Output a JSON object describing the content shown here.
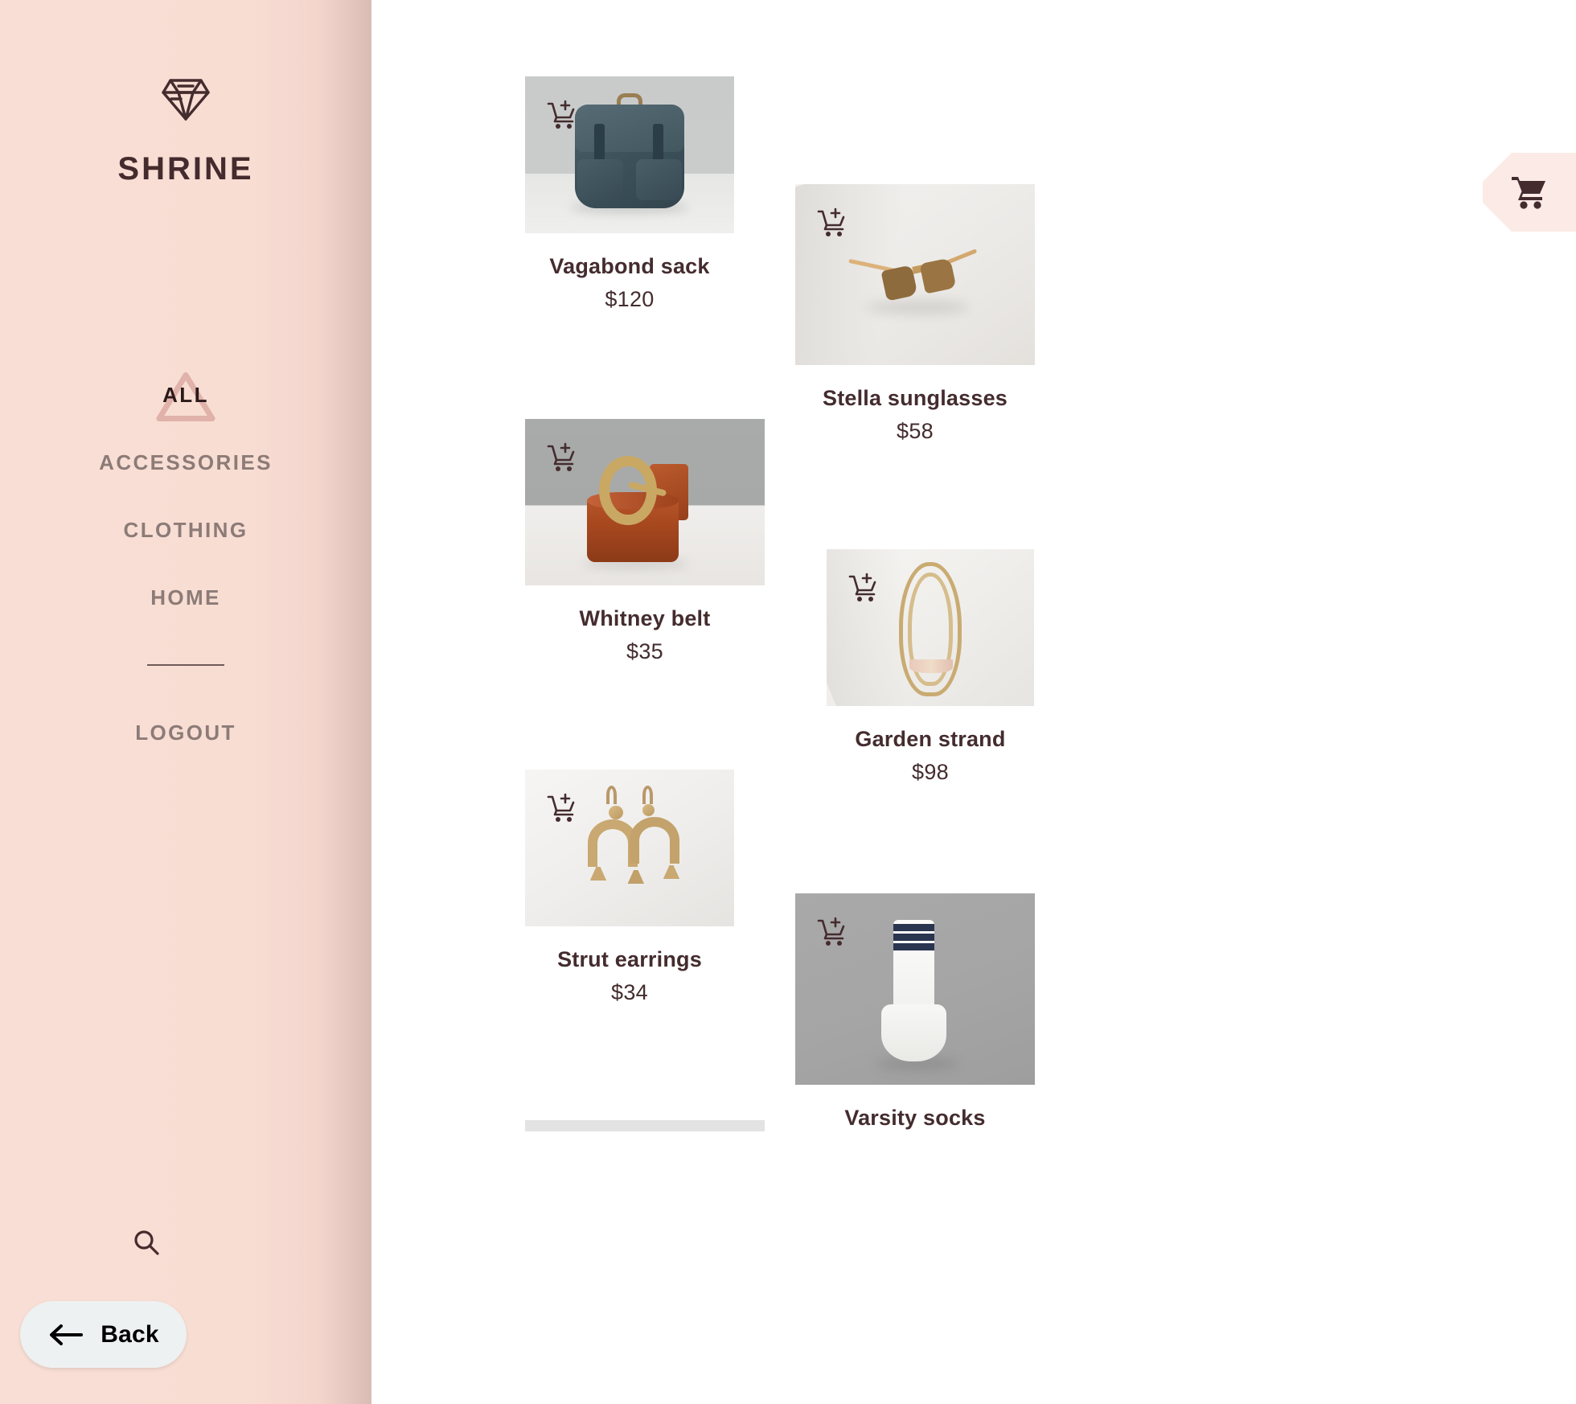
{
  "sidebar": {
    "brand": "SHRINE",
    "logo_icon": "diamond-icon",
    "nav_items": [
      {
        "label": "ALL",
        "active": true
      },
      {
        "label": "ACCESSORIES",
        "active": false
      },
      {
        "label": "CLOTHING",
        "active": false
      },
      {
        "label": "HOME",
        "active": false
      }
    ],
    "logout_label": "LOGOUT",
    "search_icon": "search-icon",
    "back_button": {
      "label": "Back",
      "icon": "arrow-left-icon"
    }
  },
  "cart_fab": {
    "icon": "shopping-cart-icon"
  },
  "colors": {
    "sidebar_bg": "#f8ded4",
    "sidebar_edge": "#d9bcb5",
    "brand_text": "#442c2e",
    "nav_inactive": "#8c7b77",
    "nav_active": "#2b1a1b",
    "triangle_accent": "#e0b2a9",
    "cart_fab_bg": "#fbeae5",
    "back_button_bg": "#eef1f1",
    "product_text": "#442c2e"
  },
  "products": [
    {
      "name": "Vagabond sack",
      "price": "$120",
      "add_icon": "add-to-cart-icon",
      "scene": "backpack"
    },
    {
      "name": "Stella sunglasses",
      "price": "$58",
      "add_icon": "add-to-cart-icon",
      "scene": "sunglasses"
    },
    {
      "name": "Whitney belt",
      "price": "$35",
      "add_icon": "add-to-cart-icon",
      "scene": "belt"
    },
    {
      "name": "Garden strand",
      "price": "$98",
      "add_icon": "add-to-cart-icon",
      "scene": "necklace"
    },
    {
      "name": "Strut earrings",
      "price": "$34",
      "add_icon": "add-to-cart-icon",
      "scene": "earrings"
    },
    {
      "name": "Varsity socks",
      "price": "",
      "add_icon": "add-to-cart-icon",
      "scene": "socks"
    }
  ]
}
